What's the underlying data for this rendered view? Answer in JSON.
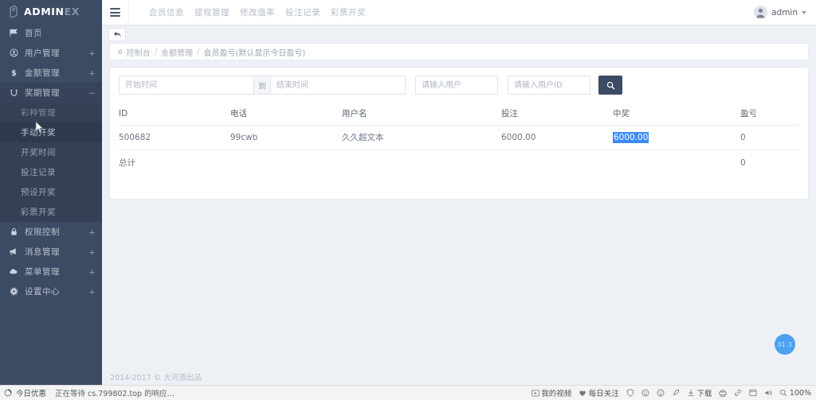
{
  "sidebar": {
    "logo": {
      "main": "ADMIN",
      "suffix": "EX",
      "icon": "pen-logo-icon"
    },
    "items": [
      {
        "label": "首页",
        "icon": "flag-icon",
        "expand": ""
      },
      {
        "label": "用户管理",
        "icon": "circle-user-icon",
        "expand": "+"
      },
      {
        "label": "金额管理",
        "icon": "dollar-icon",
        "expand": "+"
      },
      {
        "label": "奖期管理",
        "icon": "refresh-icon",
        "expand": "−"
      },
      {
        "label": "权限控制",
        "icon": "lock-icon",
        "expand": "+"
      },
      {
        "label": "消息管理",
        "icon": "megaphone-icon",
        "expand": "+"
      },
      {
        "label": "菜单管理",
        "icon": "cloud-icon",
        "expand": "+"
      },
      {
        "label": "设置中心",
        "icon": "gear-icon",
        "expand": "+"
      }
    ],
    "submenu": [
      {
        "label": "彩种管理"
      },
      {
        "label": "手动开奖"
      },
      {
        "label": "开奖时间"
      },
      {
        "label": "投注记录"
      },
      {
        "label": "预设开奖"
      },
      {
        "label": "彩票开奖"
      }
    ]
  },
  "header": {
    "menu_icon": "hamburger-icon",
    "nav": [
      {
        "label": "会员信息"
      },
      {
        "label": "提现管理"
      },
      {
        "label": "修改值率"
      },
      {
        "label": "投注记录"
      },
      {
        "label": "彩票开奖"
      }
    ],
    "user": {
      "name": "admin",
      "avatar": "user-avatar"
    }
  },
  "breadcrumb": {
    "home_icon": "home-icon",
    "items": [
      "控制台",
      "金额管理",
      "会员盈亏(默认显示今日盈亏)"
    ],
    "separator": "/"
  },
  "back_button": {
    "icon": "undo-arrow-icon"
  },
  "filters": {
    "start_placeholder": "开始时间",
    "start_value": "",
    "to_label": "到",
    "end_placeholder": "结束时间",
    "end_value": "",
    "user_placeholder": "请输入用户",
    "user_value": "",
    "uid_placeholder": "请输入用户ID",
    "uid_value": "",
    "search_icon": "search-icon"
  },
  "table": {
    "columns": [
      "ID",
      "电话",
      "用户名",
      "投注",
      "中奖",
      "盈亏"
    ],
    "rows": [
      {
        "id": "500682",
        "tel": "99cwb",
        "name": "久久超文本",
        "bet": "6000.00",
        "win": "6000.00",
        "pl": "0",
        "win_selected": true
      }
    ],
    "total": {
      "label": "总计",
      "pl": "0"
    }
  },
  "float_timer": {
    "text": "01:3"
  },
  "footer": {
    "text": "2014-2017 © 大河源出品"
  },
  "statusbar": {
    "left": {
      "icon": "loading-circle-icon",
      "link": "今日优惠",
      "status": "正在等待 cs.799802.top 的响应…"
    },
    "right": [
      {
        "icon": "video-icon",
        "label": "我的视频"
      },
      {
        "icon": "heart-icon",
        "label": "每日关注"
      },
      {
        "icon": "shield-icon",
        "label": ""
      },
      {
        "icon": "smiley-icon",
        "label": ""
      },
      {
        "icon": "face-icon",
        "label": ""
      },
      {
        "icon": "rocket-icon",
        "label": ""
      },
      {
        "icon": "download-icon",
        "label": "下载"
      },
      {
        "icon": "printer-icon",
        "label": ""
      },
      {
        "icon": "link-icon",
        "label": ""
      },
      {
        "icon": "window-icon",
        "label": ""
      },
      {
        "icon": "sound-icon",
        "label": ""
      },
      {
        "icon": "zoom-icon",
        "label": "100%"
      }
    ]
  },
  "colors": {
    "sidebar_bg": "#3c4b64",
    "submenu_bg": "#344056",
    "accent": "#3d8bfd",
    "timer": "#4ba0f0"
  }
}
